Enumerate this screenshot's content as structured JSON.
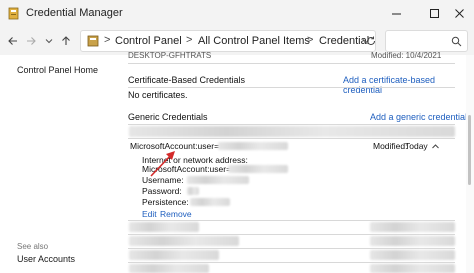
{
  "window": {
    "title": "Credential Manager",
    "buttons": [
      "minimize",
      "maximize",
      "close"
    ]
  },
  "address_bar": {
    "breadcrumbs": [
      "Control Panel",
      "All Control Panel Items",
      "Credential Manager"
    ],
    "separator": ">"
  },
  "left_pane": {
    "home_link": "Control Panel Home",
    "see_also_label": "See also",
    "user_accounts_link": "User Accounts"
  },
  "content": {
    "top_cut_row": {
      "name": "DESKTOP-GFHTRATS",
      "modified": "Modified: 10/4/2021"
    },
    "certificate_section": {
      "label": "Certificate-Based Credentials",
      "add_link": "Add a certificate-based credential",
      "empty_text": "No certificates."
    },
    "generic_section": {
      "label": "Generic Credentials",
      "add_link": "Add a generic credential"
    },
    "expanded_credential": {
      "name": "MicrosoftAccount:user=",
      "modified_label": "Modified:",
      "modified_value": "Today",
      "internet_address_label": "Internet or network address:",
      "internet_address_value": "MicrosoftAccount:user=",
      "username_label": "Username:",
      "password_label": "Password:",
      "persistence_label": "Persistence:",
      "edit_link": "Edit",
      "remove_link": "Remove"
    }
  },
  "colors": {
    "link": "#1f5fbf",
    "chrome": "#f3f3f3",
    "annotation_arrow": "#d42a2a"
  }
}
